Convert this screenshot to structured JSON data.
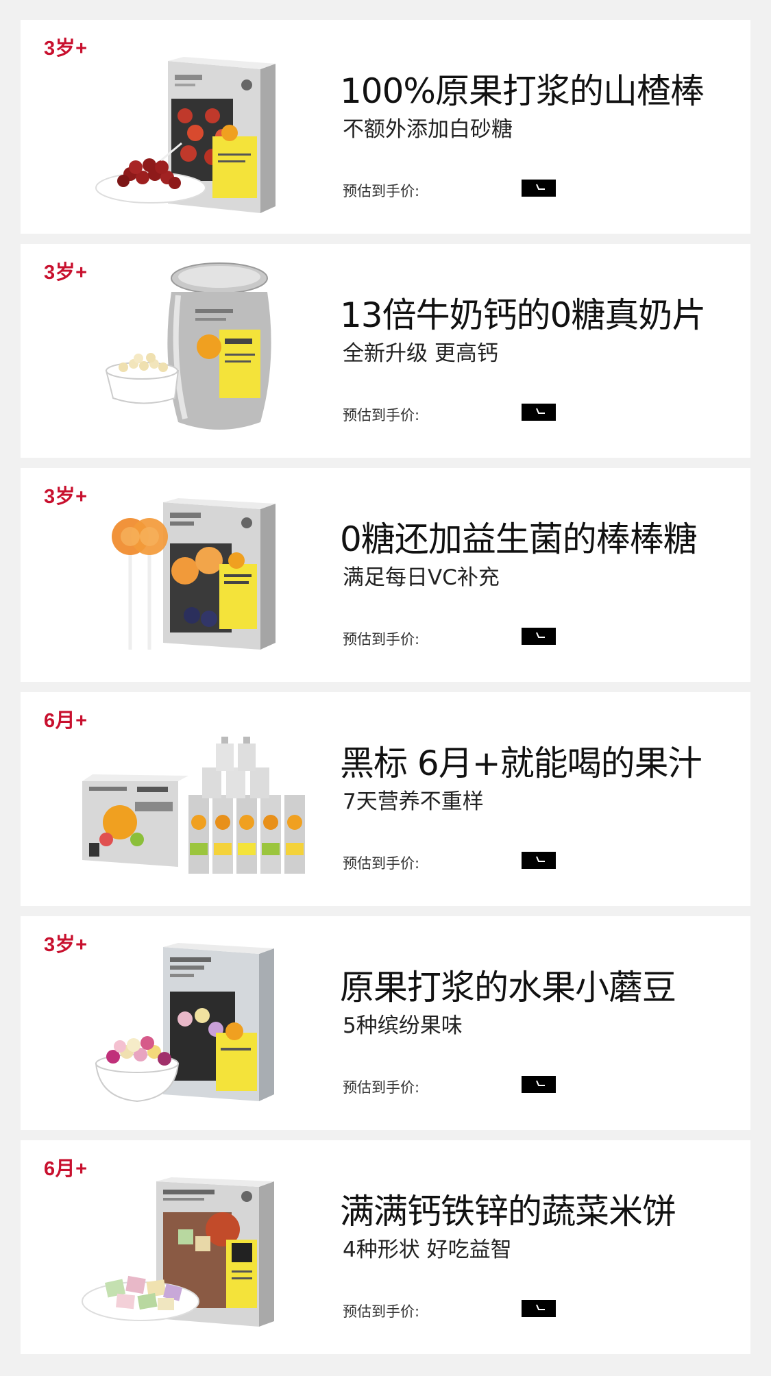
{
  "products": [
    {
      "age": "3岁+",
      "title": "100%原果打浆的山楂棒",
      "subtitle": "不额外添加白砂糖",
      "price_label": "预估到手价:",
      "image_icon": "hawthorn-stick-box-icon"
    },
    {
      "age": "3岁+",
      "title": "13倍牛奶钙的0糖真奶片",
      "subtitle": "全新升级 更高钙",
      "price_label": "预估到手价:",
      "image_icon": "milk-tablet-can-icon"
    },
    {
      "age": "3岁+",
      "title": "0糖还加益生菌的棒棒糖",
      "subtitle": "满足每日VC补充",
      "price_label": "预估到手价:",
      "image_icon": "lollipop-box-icon"
    },
    {
      "age": "6月+",
      "title": "黑标 6月+就能喝的果汁",
      "subtitle": "7天营养不重样",
      "price_label": "预估到手价:",
      "image_icon": "fruit-juice-pouch-set-icon"
    },
    {
      "age": "3岁+",
      "title": "原果打浆的水果小蘑豆",
      "subtitle": "5种缤纷果味",
      "price_label": "预估到手价:",
      "image_icon": "fruit-melts-box-icon"
    },
    {
      "age": "6月+",
      "title": "满满钙铁锌的蔬菜米饼",
      "subtitle": "4种形状 好吃益智",
      "price_label": "预估到手价:",
      "image_icon": "vegetable-rice-cracker-box-icon"
    }
  ],
  "colors": {
    "age_red": "#c8102e",
    "background": "#f1f1f1",
    "card": "#ffffff",
    "price_tag": "#000000"
  }
}
